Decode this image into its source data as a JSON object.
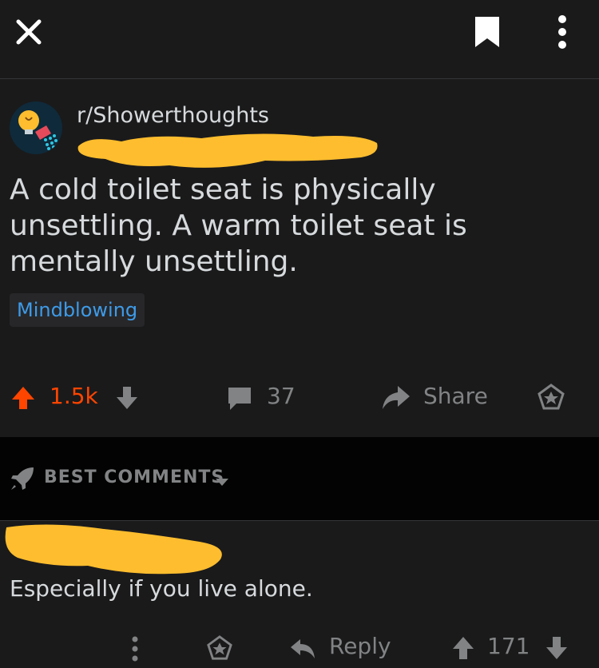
{
  "colors": {
    "background": "#1a1a1b",
    "sortbar_background": "#030303",
    "text": "#d7dadc",
    "muted": "#818384",
    "upvote": "#ff4500",
    "flair_text": "#3d9be9",
    "redaction": "#fdbd2e"
  },
  "topbar": {
    "icons": [
      "close-icon",
      "bookmark-icon",
      "more-vertical-icon"
    ]
  },
  "post": {
    "subreddit": "r/Showerthoughts",
    "subreddit_icon": "lightbulb-shower-icon",
    "title": "A cold toilet seat is physically unsettling. A warm toilet seat is mentally unsettling.",
    "flair": "Mindblowing",
    "score": "1.5k",
    "comment_count": "37",
    "share_label": "Share"
  },
  "comments_bar": {
    "sort_label": "BEST COMMENTS",
    "sort_icon": "rocket-icon"
  },
  "comment": {
    "body": "Especially if you live alone.",
    "reply_label": "Reply",
    "score": "171"
  }
}
